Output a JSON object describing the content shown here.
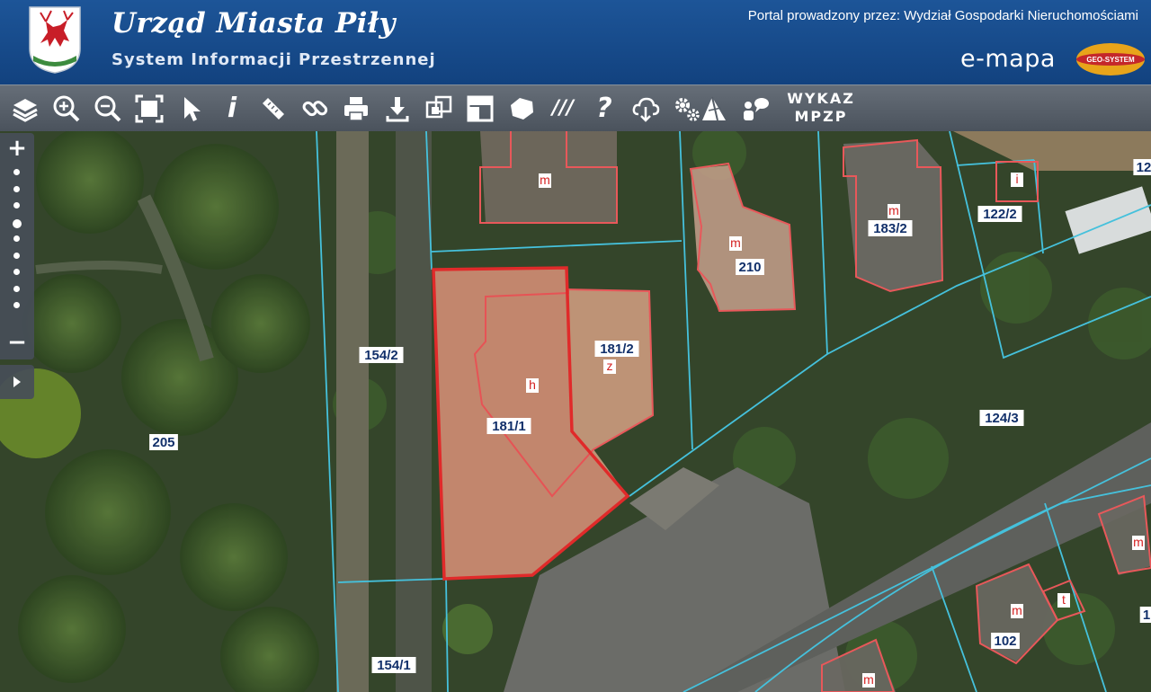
{
  "header": {
    "title": "Urząd Miasta Piły",
    "subtitle": "System Informacji Przestrzennej",
    "portal_text": "Portal prowadzony przez: Wydział Gospodarki Nieruchomościami",
    "brand": "e-mapa",
    "partner_logo_text": "GEO-SYSTEM"
  },
  "toolbar": {
    "tools": [
      "layers-icon",
      "zoom-in-icon",
      "zoom-out-icon",
      "zoom-extent-icon",
      "select-arrow-icon",
      "info-icon",
      "measure-icon",
      "link-icon",
      "print-icon",
      "download-icon",
      "compare-icon",
      "layout-icon",
      "shape-icon",
      "hatch-icon",
      "help-icon",
      "cloud-icon",
      "settings-icon",
      "terrain-icon",
      "user-comment-icon"
    ],
    "info_glyph": "i",
    "hatch_glyph": "///",
    "help_glyph": "?",
    "wykaz_line1": "WYKAZ",
    "wykaz_line2": "MPZP"
  },
  "zoom": {
    "plus": "+",
    "minus": "−",
    "level_steps": 9,
    "current_step": 3
  },
  "map": {
    "parcels": [
      "154/2",
      "205",
      "181/1",
      "181/2",
      "210",
      "183/2",
      "122/2",
      "124/3",
      "154/1",
      "102",
      "12",
      "1"
    ],
    "building_codes": [
      "m",
      "m",
      "h",
      "z",
      "m",
      "i",
      "m",
      "m",
      "t",
      "m"
    ],
    "colors": {
      "parcel_line": "#45c1dc",
      "building_line": "#e8585a",
      "selected_parcel": "#e02a2a",
      "label_text": "#12306a",
      "header_bg": "#1a4f90",
      "toolbar_bg": "#565e68"
    }
  }
}
